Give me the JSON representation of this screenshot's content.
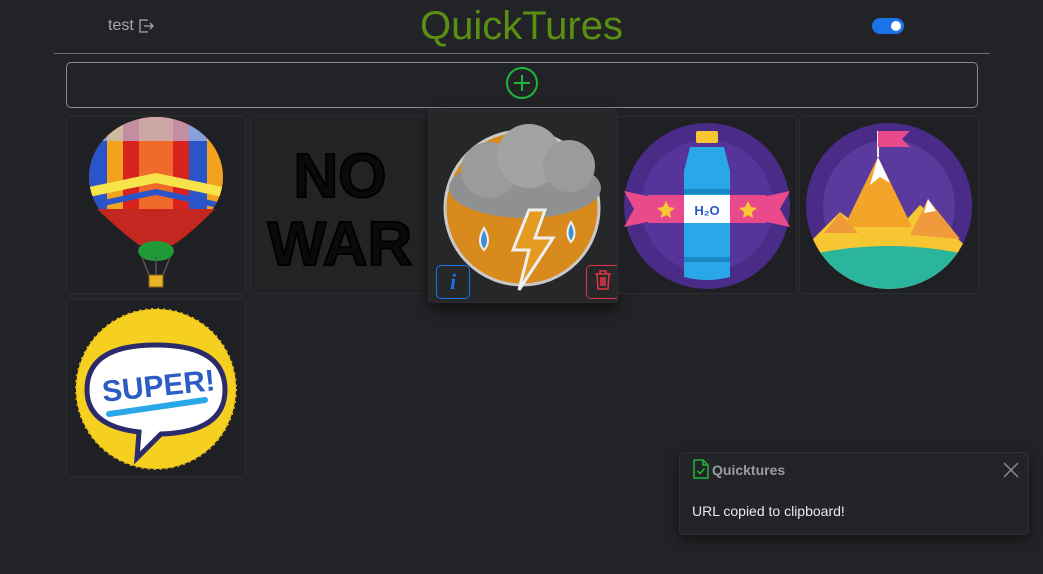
{
  "header": {
    "user_name": "test",
    "app_title": "QuickTures",
    "dark_mode_enabled": true
  },
  "toolbar": {
    "add_icon": "plus-circle-icon"
  },
  "tiles": [
    {
      "name": "hot-air-balloon-image",
      "selected": false
    },
    {
      "name": "no-war-image",
      "selected": false
    },
    {
      "name": "storm-cloud-image",
      "selected": true
    },
    {
      "name": "water-bottle-image",
      "selected": false
    },
    {
      "name": "mountain-flag-image",
      "selected": false
    },
    {
      "name": "super-speech-bubble-image",
      "selected": false
    }
  ],
  "toast": {
    "title": "Quicktures",
    "message": "URL copied to clipboard!"
  },
  "colors": {
    "brand": "#5a8f13",
    "accent": "#1a73e8",
    "danger": "#dc3545",
    "success": "#1fb53a"
  }
}
